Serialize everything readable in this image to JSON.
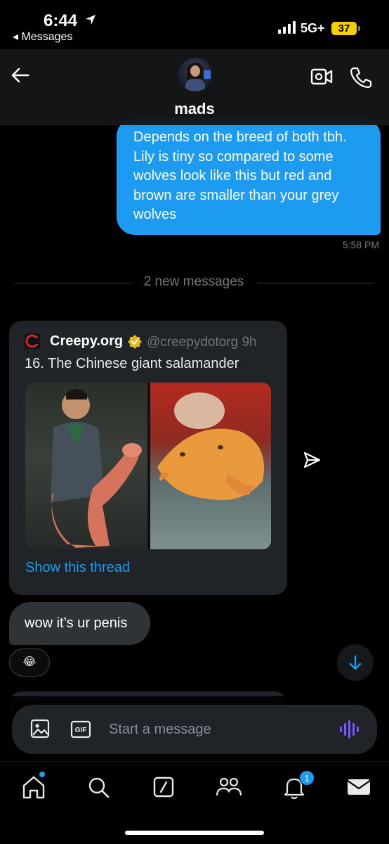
{
  "status_bar": {
    "time": "6:44",
    "back_app": "◂ Messages",
    "network": "5G+",
    "battery": "37"
  },
  "header": {
    "contact_name": "mads"
  },
  "messages": {
    "outgoing_text": "Depends on the breed of both tbh. Lily is tiny so compared to some wolves look like this but red and brown are smaller than your grey wolves",
    "outgoing_time": "5:58 PM",
    "divider_text": "2 new messages",
    "tweet": {
      "name": "Creepy.org",
      "handle_time": "@creepydotorg  9h",
      "text": "16. The Chinese giant salamander",
      "show_thread": "Show this thread"
    },
    "incoming_text": "wow it’s ur penis",
    "reaction": "😂"
  },
  "composer": {
    "placeholder": "Start a message"
  },
  "nav": {
    "notifications_count": "1"
  },
  "colors": {
    "accent": "#1d9bf0",
    "battery": "#f4cf00",
    "voice": "#7856ff"
  }
}
